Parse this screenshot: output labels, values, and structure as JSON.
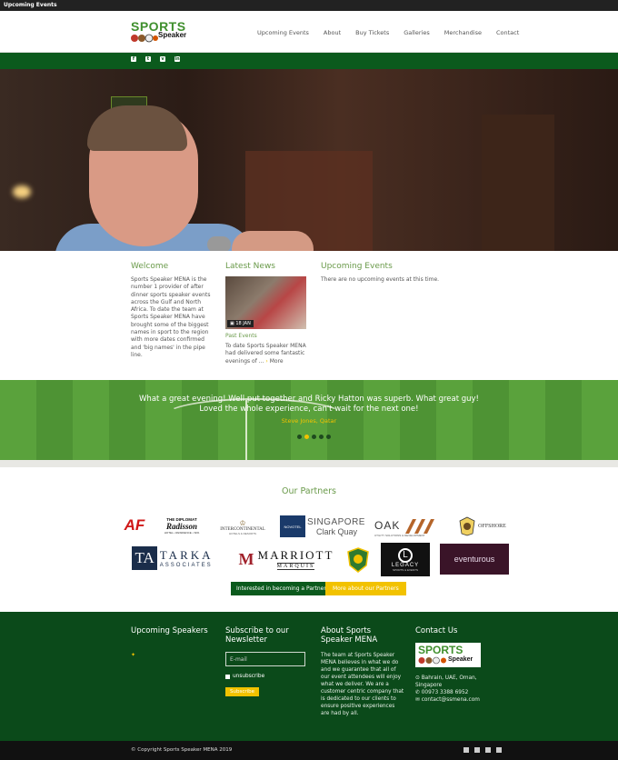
{
  "topbar": {
    "title": "Upcoming Events"
  },
  "brand": {
    "line1": "SPORTS",
    "line2": "Speaker",
    "footer_line1": "SPORTS",
    "footer_line2": "Speaker"
  },
  "nav": [
    {
      "label": "Upcoming Events"
    },
    {
      "label": "About"
    },
    {
      "label": "Buy Tickets"
    },
    {
      "label": "Galleries"
    },
    {
      "label": "Merchandise"
    },
    {
      "label": "Contact"
    }
  ],
  "social_icons": [
    "facebook-icon",
    "twitter-icon",
    "vimeo-icon",
    "linkedin-icon"
  ],
  "welcome": {
    "title": "Welcome",
    "text": "Sports Speaker MENA is the number 1 provider of after dinner sports speaker events across the Gulf and North Africa. To date the team at Sports Speaker MENA have brought some of the biggest names in sport to the region with more dates confirmed and 'big names' in the pipe line."
  },
  "news": {
    "title": "Latest News",
    "date_badge": "18 JAN",
    "category": "Past Events",
    "excerpt": "To date Sports Speaker MENA had delivered some fantastic evenings of ...",
    "more": "More"
  },
  "events": {
    "title": "Upcoming Events",
    "empty": "There are no upcoming events at this time."
  },
  "testimonial": {
    "quote": "What a great evening! Well put together and Ricky Hatton was superb. What great guy! Loved the whole experience, can't wait for the next one!",
    "author": "Steve Jones, Qatar",
    "active_dot": 2,
    "dot_count": 5
  },
  "partners": {
    "title": "Our Partners",
    "logos": {
      "af": "AF",
      "diplomat_1": "THE DIPLOMAT",
      "diplomat_2": "Radisson",
      "diplomat_3": "HOTEL • RESIDENCE • SPA",
      "inter_1": "INTERCONTINENTAL",
      "inter_2": "HOTELS & RESORTS",
      "novotel": "NOVOTEL",
      "singapore_1": "SINGAPORE",
      "singapore_2": "Clark Quay",
      "oak_1": "OAK",
      "oak_2": "UTILITY SOLUTIONS & DEVELOPMENT",
      "offshore": "OFFSHORE",
      "tarka_1": "TA",
      "tarka_2": "TARKA",
      "tarka_3": "ASSOCIATES",
      "marriott_1": "MARRIOTT",
      "marriott_2": "MARQUIS",
      "legacy_1": "LEGACY",
      "legacy_2": "SPORTS & EVENTS",
      "eventurous": "eventurous"
    },
    "btn_partner": "Interested in becoming a Partner?",
    "btn_more": "More about our Partners"
  },
  "footer": {
    "speakers_title": "Upcoming Speakers",
    "newsletter_title": "Subscribe to our Newsletter",
    "email_placeholder": "E-mail",
    "unsubscribe": "unsubscribe",
    "subscribe": "Subscribe",
    "about_title": "About Sports Speaker MENA",
    "about_text": "The team at Sports Speaker MENA believes in what we do and we guarantee that all of our event attendees will enjoy what we deliver. We are a customer centric company that is dedicated to our clients to ensure positive experiences are had by all.",
    "contact_title": "Contact Us",
    "address": "Bahrain, UAE, Oman, Singapore",
    "phone": "00973 3388 6952",
    "email": "contact@ssmena.com"
  },
  "bottom": {
    "copyright": "© Copyright Sports Speaker MENA 2019"
  },
  "colors": {
    "green_dark": "#0b5a1d",
    "green_footer": "#0b4a1a",
    "accent_yellow": "#f2c200",
    "title_green": "#6a9a4a"
  }
}
